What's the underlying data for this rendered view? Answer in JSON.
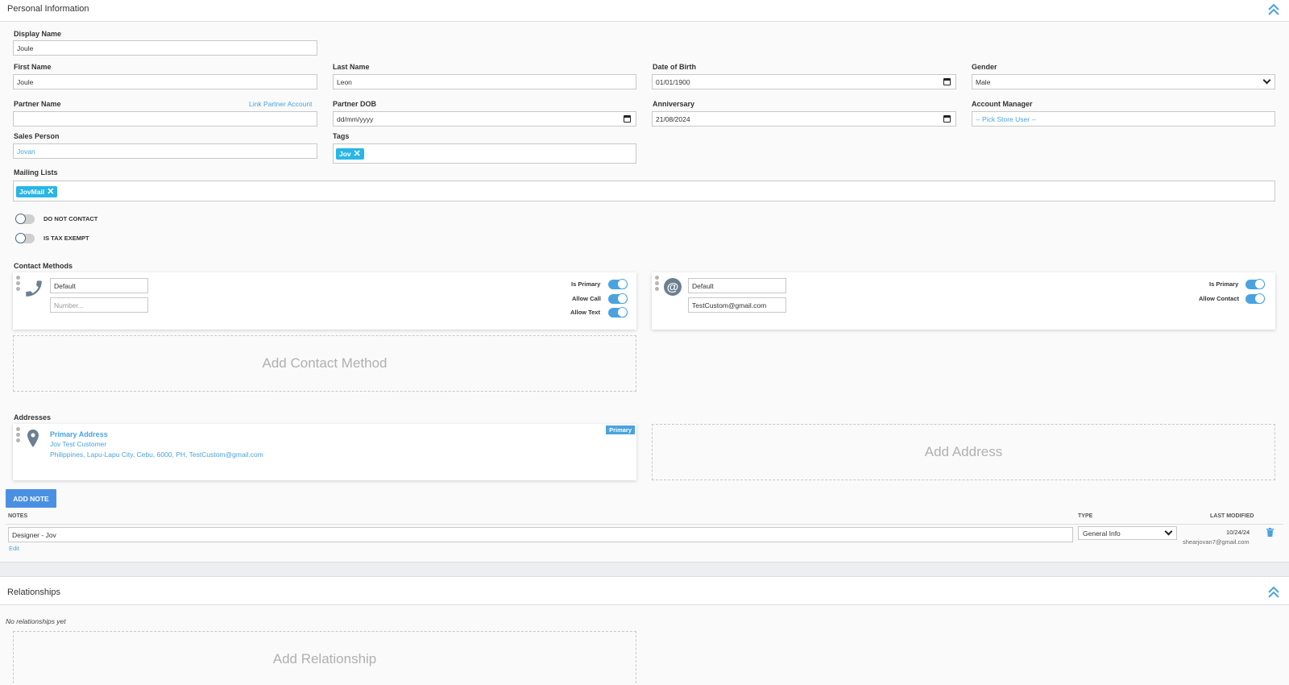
{
  "personal": {
    "title": "Personal Information",
    "display_name_label": "Display Name",
    "display_name_value": "Joule",
    "first_name_label": "First Name",
    "first_name_value": "Joule",
    "last_name_label": "Last Name",
    "last_name_value": "Leon",
    "dob_label": "Date of Birth",
    "dob_value": "01/01/1900",
    "gender_label": "Gender",
    "gender_value": "Male",
    "partner_name_label": "Partner Name",
    "partner_name_value": "",
    "link_partner_label": "Link Partner Account",
    "partner_dob_label": "Partner DOB",
    "partner_dob_value": "dd/mm/yyyy",
    "anniversary_label": "Anniversary",
    "anniversary_value": "21/08/2024",
    "account_manager_label": "Account Manager",
    "account_manager_value": "-- Pick Store User --",
    "sales_person_label": "Sales Person",
    "sales_person_value": "Jovan",
    "tags_label": "Tags",
    "tags": [
      "Jov"
    ],
    "mailing_lists_label": "Mailing Lists",
    "mailing_lists": [
      "JovMail"
    ],
    "do_not_contact_label": "DO NOT CONTACT",
    "do_not_contact": false,
    "tax_exempt_label": "IS TAX EXEMPT",
    "tax_exempt": false
  },
  "contact_methods": {
    "label": "Contact Methods",
    "phone": {
      "icon": "phone-icon",
      "type_value": "Default",
      "number_placeholder": "Number...",
      "is_primary_label": "Is Primary",
      "allow_call_label": "Allow Call",
      "allow_text_label": "Allow Text",
      "is_primary": true,
      "allow_call": true,
      "allow_text": true
    },
    "email": {
      "icon": "at-icon",
      "type_value": "Default",
      "email_value": "TestCustom@gmail.com",
      "is_primary_label": "Is Primary",
      "allow_contact_label": "Allow Contact",
      "is_primary": true,
      "allow_contact": true
    },
    "add_label": "Add Contact Method"
  },
  "addresses": {
    "label": "Addresses",
    "primary": {
      "icon": "map-pin-icon",
      "title": "Primary Address",
      "name": "Jov Test Customer",
      "line": "Philippines, Lapu-Lapu City, Cebu, 6000, PH, TestCustom@gmail.com",
      "badge": "Primary"
    },
    "add_label": "Add Address"
  },
  "notes": {
    "add_button": "ADD NOTE",
    "col_notes": "NOTES",
    "col_type": "TYPE",
    "col_modified": "LAST MODIFIED",
    "rows": [
      {
        "text": "Designer - Jov",
        "edit": "Edit",
        "type": "General Info",
        "date": "10/24/24",
        "user": "shearjovan7@gmail.com"
      }
    ]
  },
  "relationships": {
    "title": "Relationships",
    "empty": "No relationships yet",
    "add_label": "Add Relationship"
  },
  "colors": {
    "accent": "#4aa3df",
    "button": "#4a90e2",
    "tag": "#29b6e6"
  }
}
